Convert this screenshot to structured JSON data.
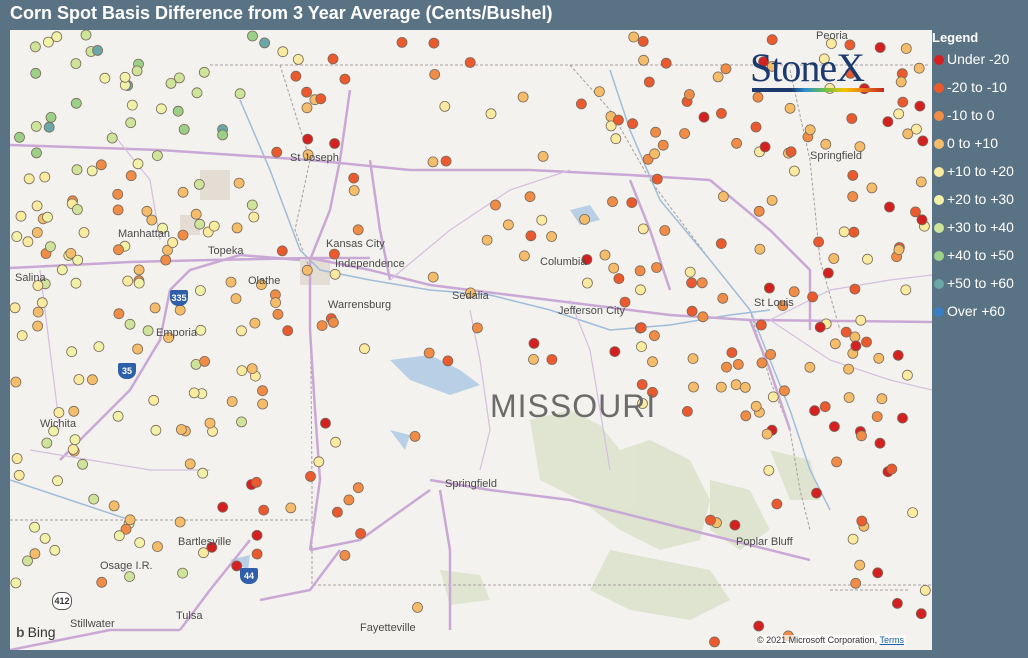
{
  "title": "Corn Spot Basis Difference from 3 Year Average (Cents/Bushel)",
  "legend": {
    "title": "Legend",
    "items": [
      {
        "label": "Under -20",
        "color": "#d42020"
      },
      {
        "label": "-20 to -10",
        "color": "#ea5a2e"
      },
      {
        "label": "-10 to 0",
        "color": "#f08c45"
      },
      {
        "label": "0 to +10",
        "color": "#f5bd6a"
      },
      {
        "label": "+10 to +20",
        "color": "#faeba0"
      },
      {
        "label": "+20 to +30",
        "color": "#f0f2a8"
      },
      {
        "label": "+30 to +40",
        "color": "#cde49a"
      },
      {
        "label": "+40 to +50",
        "color": "#9ccf88"
      },
      {
        "label": "+50 to +60",
        "color": "#6aa8a8"
      },
      {
        "label": "Over +60",
        "color": "#3a7fc4"
      }
    ]
  },
  "logo": {
    "text": "StoneX"
  },
  "map": {
    "state_label": "MISSOURI",
    "cities": [
      "St Joseph",
      "Manhattan",
      "Topeka",
      "Kansas City",
      "Independence",
      "Olathe",
      "Salina",
      "Emporia",
      "Warrensburg",
      "Sedalia",
      "Columbia",
      "Jefferson City",
      "St Louis",
      "Springfield",
      "Springfield",
      "Wichita",
      "Bartlesville",
      "Osage I.R.",
      "Tulsa",
      "Stillwater",
      "Fayetteville",
      "Poplar Bluff",
      "Peoria"
    ],
    "shields": [
      "335",
      "35",
      "44",
      "412"
    ]
  },
  "attribution": {
    "bing": "Bing",
    "copyright": "© 2021 Microsoft Corporation",
    "terms": "Terms"
  }
}
